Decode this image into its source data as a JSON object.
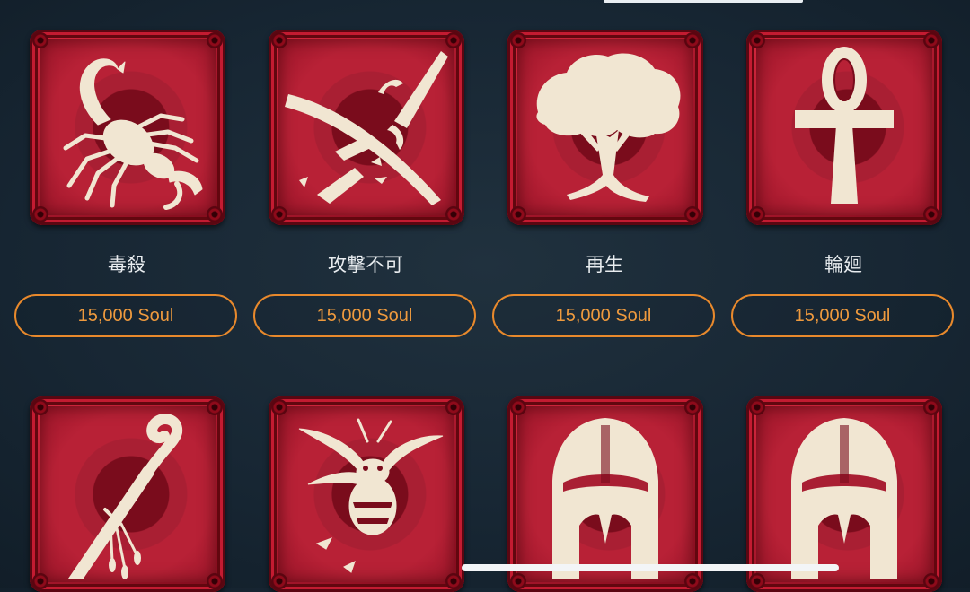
{
  "shop": {
    "items": [
      {
        "name": "毒殺",
        "price": "15,000 Soul",
        "icon": "scorpion-icon"
      },
      {
        "name": "攻撃不可",
        "price": "15,000 Soul",
        "icon": "broken-sword-icon"
      },
      {
        "name": "再生",
        "price": "15,000 Soul",
        "icon": "tree-icon"
      },
      {
        "name": "輪廻",
        "price": "15,000 Soul",
        "icon": "ankh-icon"
      },
      {
        "icon": "shepherd-staff-icon"
      },
      {
        "icon": "wasp-icon"
      },
      {
        "icon": "helmet-icon"
      },
      {
        "icon": "helmet-icon"
      }
    ]
  },
  "colors": {
    "background": "#172633",
    "tile_red": "#b81f35",
    "tile_frame": "#62070f",
    "icon_cream": "#f1e6d2",
    "price_orange": "#e8892c",
    "text": "#e8ecef"
  }
}
